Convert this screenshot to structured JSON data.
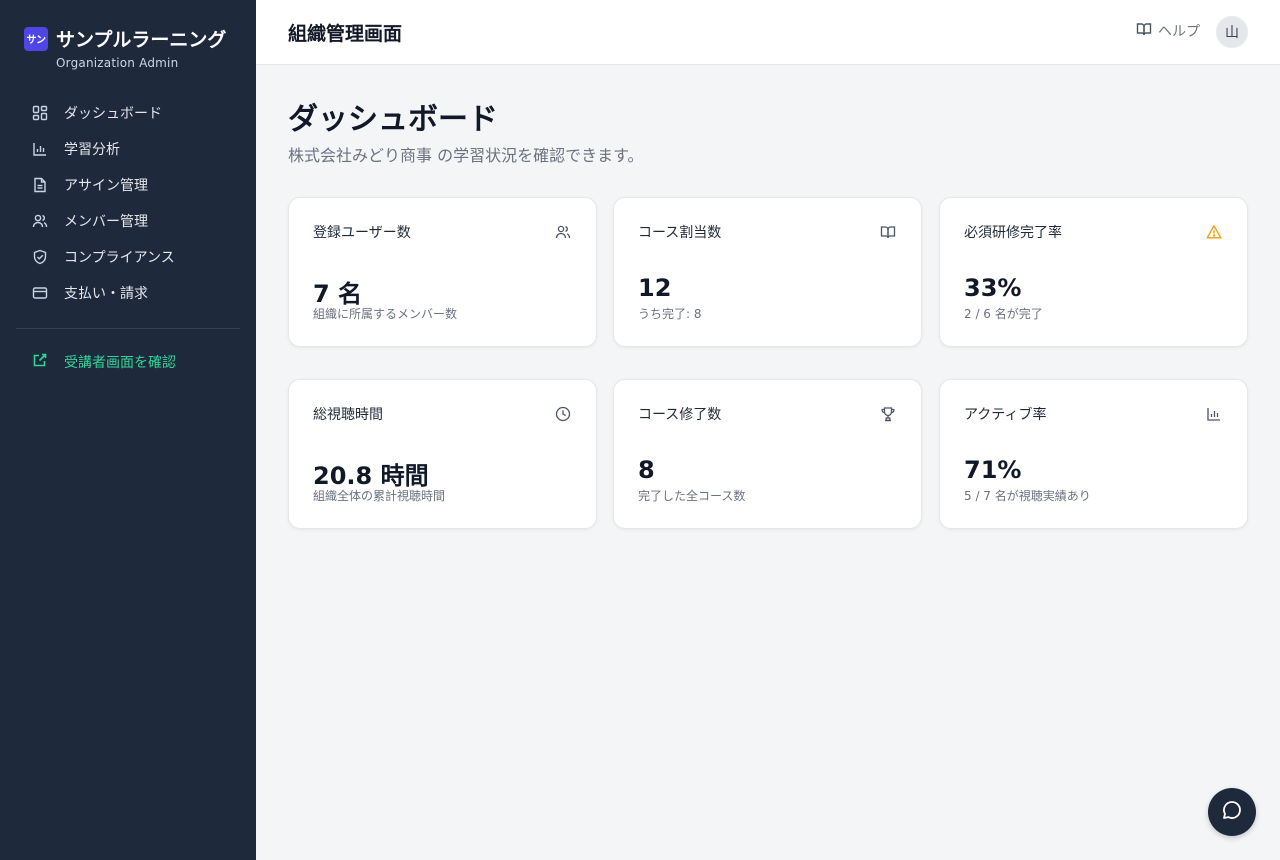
{
  "brand": {
    "logo_text": "サン",
    "name": "サンプルラーニング",
    "subtitle": "Organization Admin"
  },
  "sidebar": {
    "items": [
      {
        "label": "ダッシュボード",
        "icon": "dashboard-icon"
      },
      {
        "label": "学習分析",
        "icon": "bar-chart-icon"
      },
      {
        "label": "アサイン管理",
        "icon": "document-icon"
      },
      {
        "label": "メンバー管理",
        "icon": "users-icon"
      },
      {
        "label": "コンプライアンス",
        "icon": "shield-icon"
      },
      {
        "label": "支払い・請求",
        "icon": "credit-card-icon"
      }
    ],
    "learner_link": {
      "label": "受講者画面を確認",
      "icon": "external-link-icon"
    }
  },
  "header": {
    "title": "組織管理画面",
    "help_label": "ヘルプ",
    "avatar_initial": "山"
  },
  "main": {
    "title": "ダッシュボード",
    "subtitle": "株式会社みどり商事 の学習状況を確認できます。"
  },
  "stats": [
    {
      "label": "登録ユーザー数",
      "value": "7 名",
      "note": "組織に所属するメンバー数",
      "icon": "users-icon"
    },
    {
      "label": "コース割当数",
      "value": "12",
      "note": "うち完了: 8",
      "icon": "book-open-icon"
    },
    {
      "label": "必須研修完了率",
      "value": "33%",
      "note": "2 / 6 名が完了",
      "icon": "warning-icon"
    },
    {
      "label": "総視聴時間",
      "value": "20.8 時間",
      "note": "組織全体の累計視聴時間",
      "icon": "clock-icon"
    },
    {
      "label": "コース修了数",
      "value": "8",
      "note": "完了した全コース数",
      "icon": "trophy-icon"
    },
    {
      "label": "アクティブ率",
      "value": "71%",
      "note": "5 / 7 名が視聴実績あり",
      "icon": "bar-chart-icon"
    }
  ],
  "colors": {
    "sidebar_bg": "#1e293b",
    "accent_green": "#34d399",
    "warning": "#f59e0b",
    "brand": "#4f46e5"
  }
}
